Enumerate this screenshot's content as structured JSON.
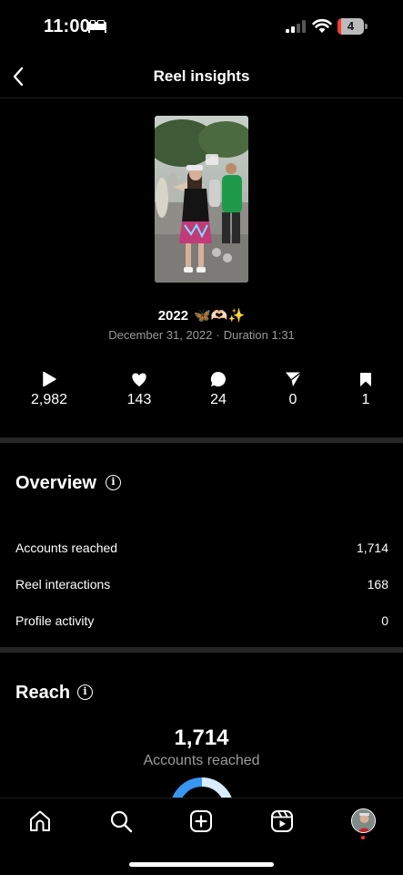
{
  "status_bar": {
    "time": "11:00",
    "battery_level": "4",
    "battery_fraction": 0.15,
    "battery_color": "#ff3b30",
    "icons": [
      "sleep-icon",
      "signal-icon",
      "wifi-icon",
      "battery-icon"
    ]
  },
  "header": {
    "title": "Reel insights",
    "back_icon": "chevron-left-icon"
  },
  "reel": {
    "title": "2022",
    "title_emojis": "🦋🫶🏻✨",
    "date": "December 31, 2022",
    "separator": "·",
    "duration": "Duration 1:31"
  },
  "stats": [
    {
      "icon": "play-icon",
      "value": "2,982"
    },
    {
      "icon": "heart-icon",
      "value": "143"
    },
    {
      "icon": "comment-icon",
      "value": "24"
    },
    {
      "icon": "share-icon",
      "value": "0"
    },
    {
      "icon": "save-icon",
      "value": "1"
    }
  ],
  "overview": {
    "title": "Overview",
    "rows": [
      {
        "label": "Accounts reached",
        "value": "1,714"
      },
      {
        "label": "Reel interactions",
        "value": "168"
      },
      {
        "label": "Profile activity",
        "value": "0"
      }
    ]
  },
  "reach": {
    "title": "Reach",
    "value": "1,714",
    "label": "Accounts reached",
    "donut_colors": {
      "primary": "#3797f0",
      "secondary": "#d9ecff"
    }
  },
  "tab_bar": {
    "items": [
      "home-icon",
      "search-icon",
      "create-icon",
      "reels-icon",
      "profile-avatar"
    ],
    "notification_dot_color": "#ff3040"
  },
  "info_glyph": "i"
}
